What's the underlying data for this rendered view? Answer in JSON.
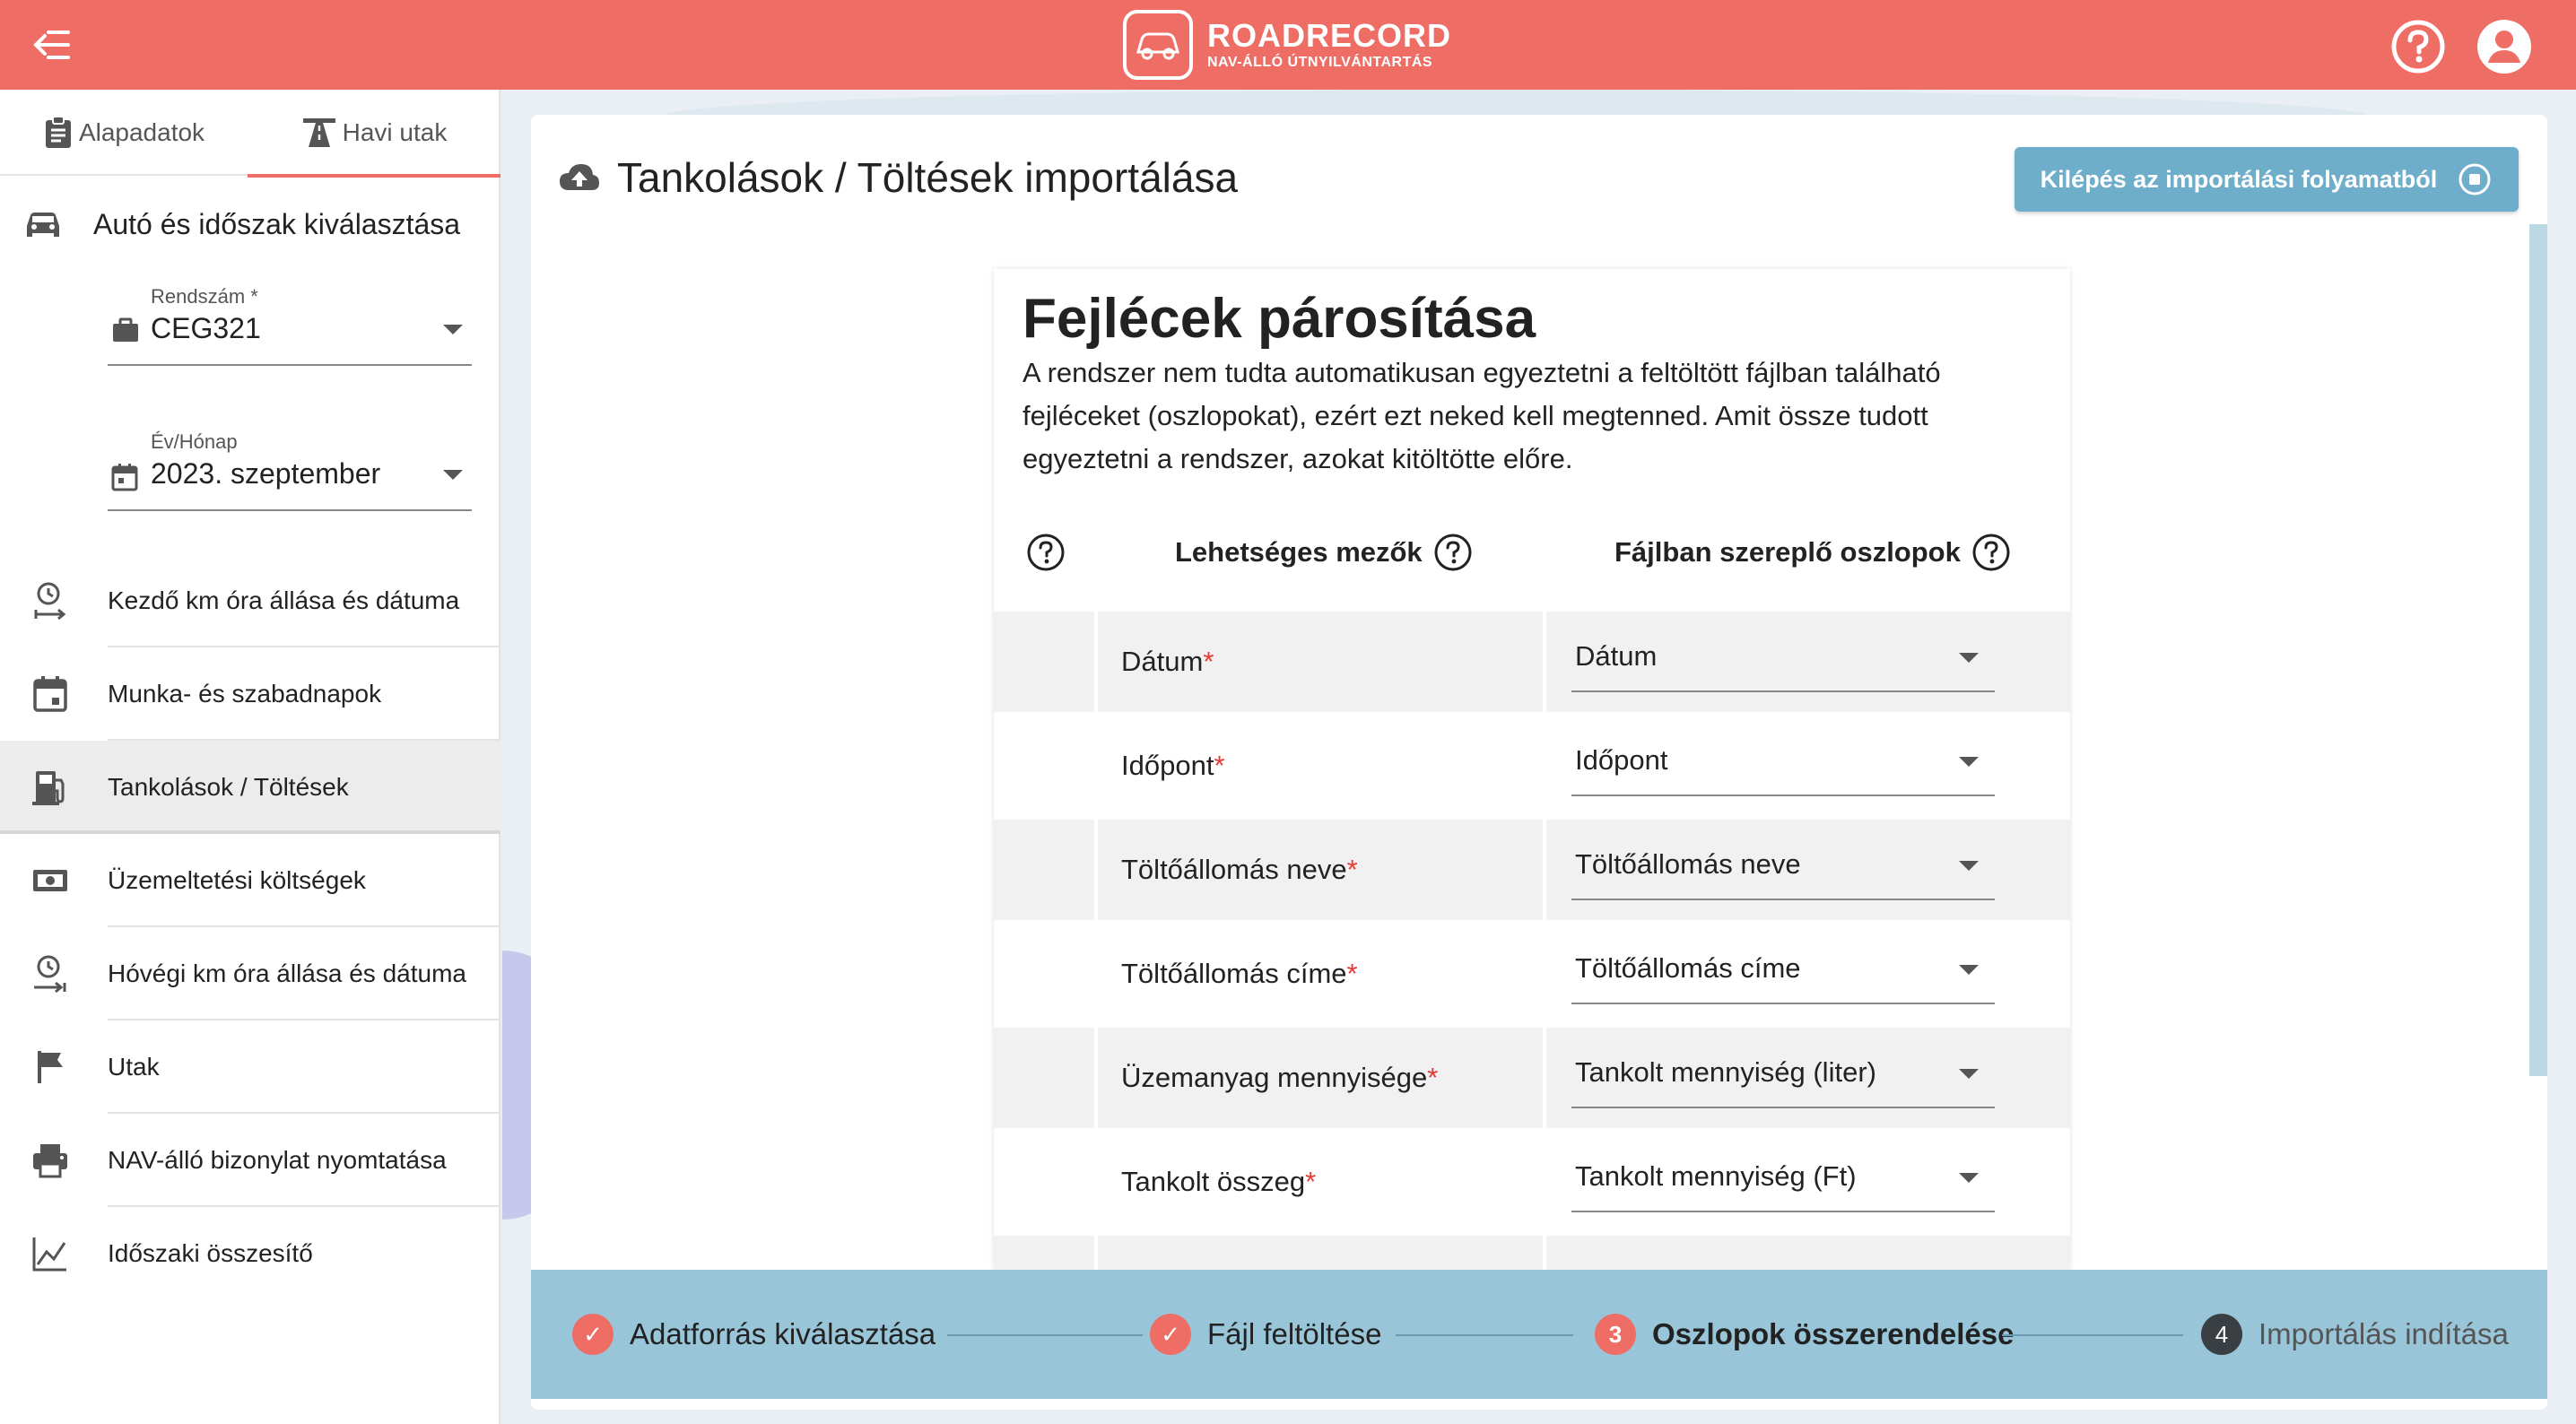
{
  "app": {
    "logo_title": "ROADRECORD",
    "logo_subtitle": "NAV-ÁLLÓ ÚTNYILVÁNTARTÁS",
    "accent": "#ee6e66"
  },
  "sidebar": {
    "tabs": [
      {
        "label": "Alapadatok",
        "icon": "clipboard-icon"
      },
      {
        "label": "Havi utak",
        "icon": "road-icon",
        "active": true
      }
    ],
    "section_title": "Autó és időszak kiválasztása",
    "plate": {
      "label": "Rendszám *",
      "value": "CEG321"
    },
    "period": {
      "label": "Év/Hónap",
      "value": "2023. szeptember"
    },
    "items": [
      {
        "label": "Kezdő km óra állása és dátuma",
        "icon": "clock-start-icon"
      },
      {
        "label": "Munka- és szabadnapok",
        "icon": "calendar-icon"
      },
      {
        "label": "Tankolások / Töltések",
        "icon": "fuel-pump-icon",
        "active": true
      },
      {
        "label": "Üzemeltetési költségek",
        "icon": "money-icon"
      },
      {
        "label": "Hóvégi km óra állása és dátuma",
        "icon": "clock-end-icon"
      },
      {
        "label": "Utak",
        "icon": "flag-icon"
      },
      {
        "label": "NAV-álló bizonylat nyomtatása",
        "icon": "printer-icon"
      },
      {
        "label": "Időszaki összesítő",
        "icon": "line-chart-icon"
      }
    ]
  },
  "main": {
    "title": "Tankolások / Töltések importálása",
    "exit_button": "Kilépés az importálási folyamatból",
    "panel_title": "Fejlécek párosítása",
    "panel_desc": "A rendszer nem tudta automatikusan egyeztetni a feltöltött fájlban található fejléceket (oszlopokat), ezért ezt neked kell megtenned. Amit össze tudott egyeztetni a rendszer, azokat kitöltötte előre.",
    "col_possible": "Lehetséges mezők",
    "col_file": "Fájlban szereplő oszlopok",
    "rows": [
      {
        "field": "Dátum",
        "value": "Dátum"
      },
      {
        "field": "Időpont",
        "value": "Időpont"
      },
      {
        "field": "Töltőállomás neve",
        "value": "Töltőállomás neve"
      },
      {
        "field": "Töltőállomás címe",
        "value": "Töltőállomás címe"
      },
      {
        "field": "Üzemanyag mennyisége",
        "value": "Tankolt mennyiség (liter)"
      },
      {
        "field": "Tankolt összeg",
        "value": "Tankolt mennyiség (Ft)"
      }
    ]
  },
  "stepper": [
    {
      "label": "Adatforrás kiválasztása",
      "state": "done",
      "mark": "✓"
    },
    {
      "label": "Fájl feltöltése",
      "state": "done",
      "mark": "✓"
    },
    {
      "label": "Oszlopok összerendelése",
      "state": "current",
      "mark": "3"
    },
    {
      "label": "Importálás indítása",
      "state": "todo",
      "mark": "4"
    }
  ]
}
